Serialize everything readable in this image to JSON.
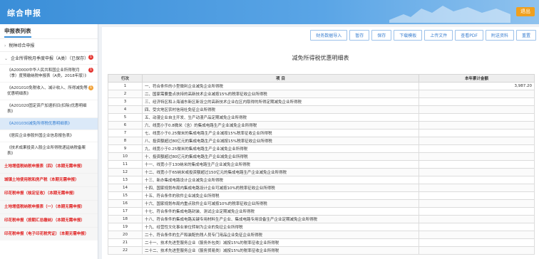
{
  "header": {
    "title": "综合申报",
    "exit_label": "退出"
  },
  "sidebar": {
    "title": "申报表列表",
    "groups": [
      {
        "label": "税种综合申报"
      },
      {
        "label": "企业所得税月季度申报（A类）（已保存）",
        "badge": "1"
      }
    ],
    "items": [
      {
        "label": "《A200000中华人民共和国企业所得税月（季）度预缴纳税申报表（A类，2018年版）》",
        "badge": "1"
      },
      {
        "label": "《A201010免税收入、减计收入、所得减免等优惠明细表》",
        "badge": "1"
      },
      {
        "label": "《A201020固定资产加速折旧(扣除)优惠明细表》"
      },
      {
        "label": "《A201030减免所得税优惠明细表》"
      },
      {
        "label": "《居民企业参股外国企业信息报告表》"
      },
      {
        "label": "《技术成果投资入股企业所得税递延纳税备案表》"
      }
    ],
    "red_items": [
      "土地增值税纳税申报表（四）（本期无需申报）",
      "城镇土地使用税和房产税（本期无需申报）",
      "印花税申报（核定征收）（本期无需申报）",
      "土地增值税纳税申报表（一）（本期无需申报）",
      "印花税申报（按期汇总缴纳）（本期无需申报）",
      "印花税申报（电子印花税凭证）（本期无需申报）"
    ]
  },
  "toolbar": [
    "财务数据导入",
    "暂存",
    "保存",
    "下载模板",
    "上传文件",
    "查看PDF",
    "附送资料",
    "重置"
  ],
  "report": {
    "title": "减免所得税优惠明细表",
    "columns": [
      "行次",
      "项    目",
      "本年累计金额"
    ],
    "rows": [
      {
        "n": "1",
        "item": "一、符合条件的小型微利企业减免企业所得税",
        "v": "3,987.20"
      },
      {
        "n": "2",
        "item": "二、国家需要重点扶持的高新技术企业减按15%的税率征收企业所得税",
        "v": ""
      },
      {
        "n": "3",
        "item": "三、经济特区和上海浦东新区新设立的高新技术企业在区内取得的所得定期减免企业所得税",
        "v": ""
      },
      {
        "n": "4",
        "item": "四、受灾地区农村信用社免征企业所得税",
        "v": ""
      },
      {
        "n": "5",
        "item": "五、动漫企业自主开发、生产动漫产品定期减免企业所得税",
        "v": ""
      },
      {
        "n": "6",
        "item": "六、线宽小于0.8微米（含）的集成电路生产企业减免企业所得税",
        "v": ""
      },
      {
        "n": "7",
        "item": "七、线宽小于0.25微米的集成电路生产企业减按15%税率征收企业所得税",
        "v": ""
      },
      {
        "n": "8",
        "item": "八、投资额超过80亿元的集成电路生产企业减按15%税率征收企业所得税",
        "v": ""
      },
      {
        "n": "9",
        "item": "九、线宽小于0.25微米的集成电路生产企业减免企业所得税",
        "v": ""
      },
      {
        "n": "10",
        "item": "十、投资额超过80亿元的集成电路生产企业减免企业所得税",
        "v": ""
      },
      {
        "n": "11",
        "item": "十一、线宽小于130纳米的集成电路生产企业减免企业所得税",
        "v": ""
      },
      {
        "n": "12",
        "item": "十二、线宽小于65纳米或投资额超过150亿元的集成电路生产企业减免企业所得税",
        "v": ""
      },
      {
        "n": "13",
        "item": "十三、新办集成电路设计企业减免企业所得税",
        "v": ""
      },
      {
        "n": "14",
        "item": "十四、国家规划布局内集成电路设计企业可减按10%的税率征收企业所得税",
        "v": ""
      },
      {
        "n": "15",
        "item": "十五、符合条件的软件企业减免企业所得税",
        "v": ""
      },
      {
        "n": "16",
        "item": "十六、国家规划布局内重点软件企业可减按10%的税率征收企业所得税",
        "v": ""
      },
      {
        "n": "17",
        "item": "十七、符合条件的集成电路封装、测试企业定期减免企业所得税",
        "v": ""
      },
      {
        "n": "18",
        "item": "十八、符合条件的集成电路关键专用材料生产企业、集成电路专用设备生产企业定期减免企业所得税",
        "v": ""
      },
      {
        "n": "19",
        "item": "十九、经营性文化事业单位转制为企业的免征企业所得税",
        "v": ""
      },
      {
        "n": "20",
        "item": "二十、符合条件的生产和装配伤残人员专门用品企业免征企业所得税",
        "v": ""
      },
      {
        "n": "21",
        "item": "二十一、技术先进型服务企业（服务外包类）减按15%的税率征收企业所得税",
        "v": ""
      },
      {
        "n": "22",
        "item": "二十二、技术先进型服务企业（服务贸易类）减按15%的税率征收企业所得税",
        "v": ""
      }
    ]
  }
}
